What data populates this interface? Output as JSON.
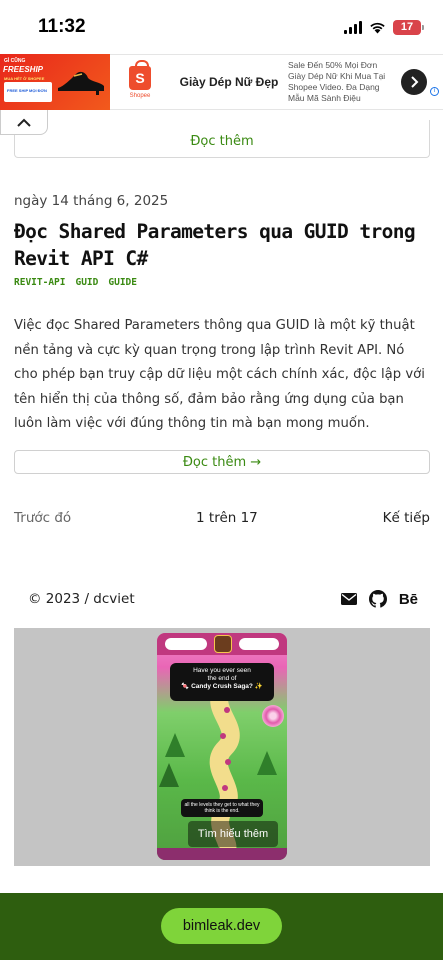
{
  "status_bar": {
    "time": "11:32",
    "battery": "17"
  },
  "ad_banner": {
    "promo_top": "GÌ CŨNG",
    "promo_main": "FREESHIP",
    "promo_sub": "MUA HÉT Ở SHOPEE",
    "promo_left": "FREE SHIP",
    "promo_right": "MỌI ĐƠN",
    "brand": "Shopee",
    "headline": "Giày Dép Nữ Đẹp",
    "description": "Sale Đến 50% Mọi Đơn Giày Dép Nữ Khi Mua Tại Shopee Video. Đa Dạng Mẫu Mã Sành Điệu",
    "info": "i"
  },
  "prev_read_more": "Đọc thêm",
  "post": {
    "date": "ngày 14 tháng 6, 2025",
    "title": "Đọc Shared Parameters qua GUID trong Revit API C#",
    "tags": [
      "REVIT-API",
      "GUID",
      "GUIDE"
    ],
    "excerpt": "Việc đọc Shared Parameters thông qua GUID là một kỹ thuật nền tảng và cực kỳ quan trọng trong lập trình Revit API. Nó cho phép bạn truy cập dữ liệu một cách chính xác, độc lập với tên hiển thị của thông số, đảm bảo rằng ứng dụng của bạn luôn làm việc với đúng thông tin mà bạn mong muốn.",
    "read_more": "Đọc thêm →"
  },
  "pagination": {
    "prev": "Trước đó",
    "current": "1 trên 17",
    "next": "Kế tiếp"
  },
  "footer": {
    "copyright": "© 2023 / dcviet",
    "behance": "Bē"
  },
  "game_ad": {
    "bubble_line1": "Have you ever seen",
    "bubble_line2": "the end of",
    "bubble_line3": "🍬 Candy Crush Saga? ✨",
    "caption": "all the levels they get to what they think is the end.",
    "cta": "Tìm hiểu thêm"
  },
  "bottom_bar": {
    "url": "bimleak.dev"
  }
}
